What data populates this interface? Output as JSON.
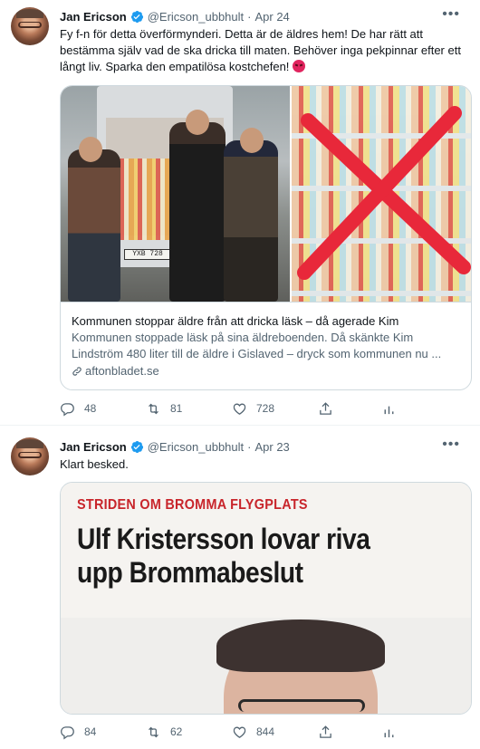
{
  "tweets": [
    {
      "author_name": "Jan Ericson",
      "handle": "@Ericson_ubbhult",
      "separator": "·",
      "date": "Apr 24",
      "text": "Fy f-n för detta överförmynderi. Detta är de äldres hem! De har rätt att bestämma själv vad de ska dricka till maten. Behöver inga pekpinnar efter ett långt liv. Sparka den empatilösa  kostchefen!",
      "emoji_icon": "angry-face-icon",
      "card": {
        "image_left_plate": "YXB 728",
        "title": "Kommunen stoppar äldre från att dricka läsk – då agerade Kim",
        "description": "Kommunen stoppade läsk på sina äldreboenden. Då skänkte Kim Lindström 480 liter till de äldre i Gislaved – dryck som kommunen nu ...",
        "domain": "aftonbladet.se"
      },
      "replies": "48",
      "retweets": "81",
      "likes": "728"
    },
    {
      "author_name": "Jan Ericson",
      "handle": "@Ericson_ubbhult",
      "separator": "·",
      "date": "Apr 23",
      "text": "Klart besked.",
      "card": {
        "kicker": "STRIDEN OM BROMMA FLYGPLATS",
        "headline_line1": "Ulf Kristersson lovar riva",
        "headline_line2": "upp Brommabeslut"
      },
      "replies": "84",
      "retweets": "62",
      "likes": "844"
    }
  ],
  "more_icon": "•••",
  "colors": {
    "accent": "#1d9bf0",
    "secondary_text": "#536471",
    "border": "#cfd9de",
    "kicker_red": "#c8252b"
  }
}
